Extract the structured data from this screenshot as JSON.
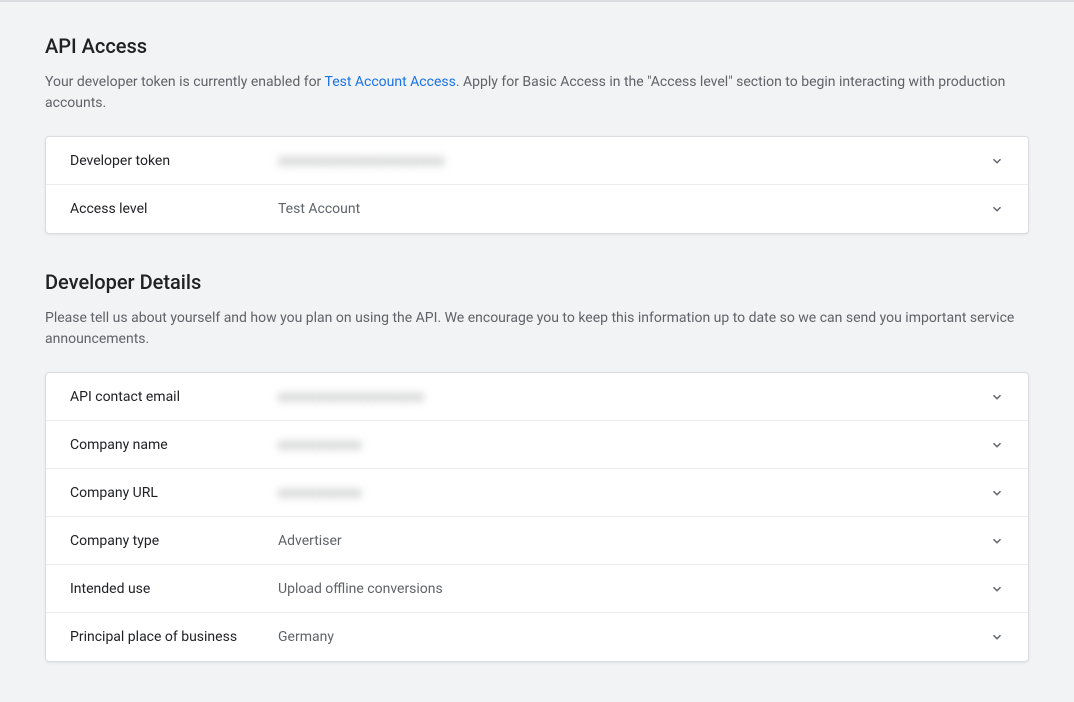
{
  "api_access": {
    "title": "API Access",
    "desc_before": "Your developer token is currently enabled for ",
    "desc_link": "Test Account Access",
    "desc_after": ". Apply for Basic Access in the \"Access level\" section to begin interacting with production accounts.",
    "rows": {
      "developer_token": {
        "label": "Developer token",
        "value": "xxxxxxxxxxxxxxxxxxxxxxxx"
      },
      "access_level": {
        "label": "Access level",
        "value": "Test Account"
      }
    }
  },
  "developer_details": {
    "title": "Developer Details",
    "desc": "Please tell us about yourself and how you plan on using the API. We encourage you to keep this information up to date so we can send you important service announcements.",
    "rows": {
      "api_contact_email": {
        "label": "API contact email",
        "value": "xxxxxxxxxxxxxxxxxxxxx"
      },
      "company_name": {
        "label": "Company name",
        "value": "xxxxxxxxxxxx"
      },
      "company_url": {
        "label": "Company URL",
        "value": "xxxxxxxxxxxx"
      },
      "company_type": {
        "label": "Company type",
        "value": "Advertiser"
      },
      "intended_use": {
        "label": "Intended use",
        "value": "Upload offline conversions"
      },
      "principal_place": {
        "label": "Principal place of business",
        "value": "Germany"
      }
    }
  }
}
